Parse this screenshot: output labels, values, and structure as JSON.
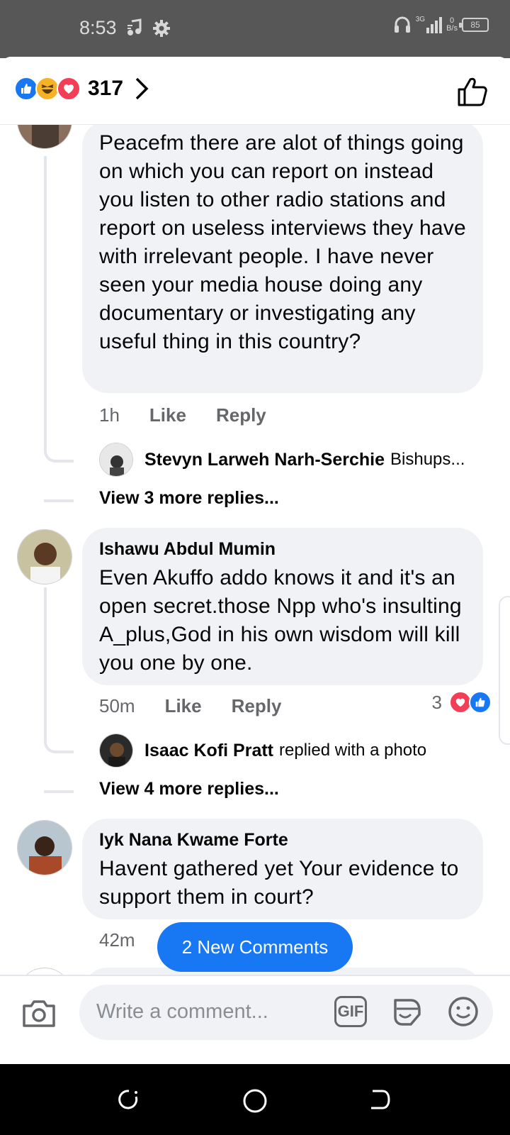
{
  "status_bar": {
    "time": "8:53",
    "network": "3G",
    "net_speed_value": "0",
    "net_speed_unit": "B/s",
    "battery": "85",
    "icons": [
      "music-note-icon",
      "gear-icon",
      "headphones-icon",
      "signal-icon",
      "battery-icon"
    ]
  },
  "header": {
    "reaction_count": "317",
    "reaction_icons": [
      "like-icon",
      "haha-icon",
      "love-icon"
    ]
  },
  "comments": [
    {
      "text": "Peacefm there are alot of things going on which you can report on instead you listen to other radio stations and report on useless interviews they have with irrelevant people. I have never seen your media house doing any documentary or investigating any useful thing in this country?",
      "time": "1h",
      "like_label": "Like",
      "reply_label": "Reply",
      "reply_preview": {
        "name": "Stevyn Larweh Narh-Serchie",
        "text": "Bishups..."
      },
      "view_more": "View 3 more replies..."
    },
    {
      "author": "Ishawu Abdul Mumin",
      "text": "Even Akuffo addo knows it and it's an open secret.those Npp who's insulting A_plus,God in his own wisdom will kill you one by one.",
      "time": "50m",
      "like_label": "Like",
      "reply_label": "Reply",
      "reaction_count": "3",
      "reply_preview": {
        "name": "Isaac Kofi Pratt",
        "text": "replied with a photo"
      },
      "view_more": "View 4 more replies..."
    },
    {
      "author": "Iyk Nana Kwame Forte",
      "text": "Havent gathered yet Your evidence to support them in court?",
      "time": "42m"
    }
  ],
  "new_comments_label": "2 New Comments",
  "composer": {
    "placeholder": "Write a comment...",
    "gif_label": "GIF"
  },
  "colors": {
    "facebook_blue": "#1877f2",
    "bubble_bg": "#f0f2f5",
    "meta_gray": "#65676b",
    "love_red": "#f33e58",
    "haha_yellow": "#f7b125"
  }
}
